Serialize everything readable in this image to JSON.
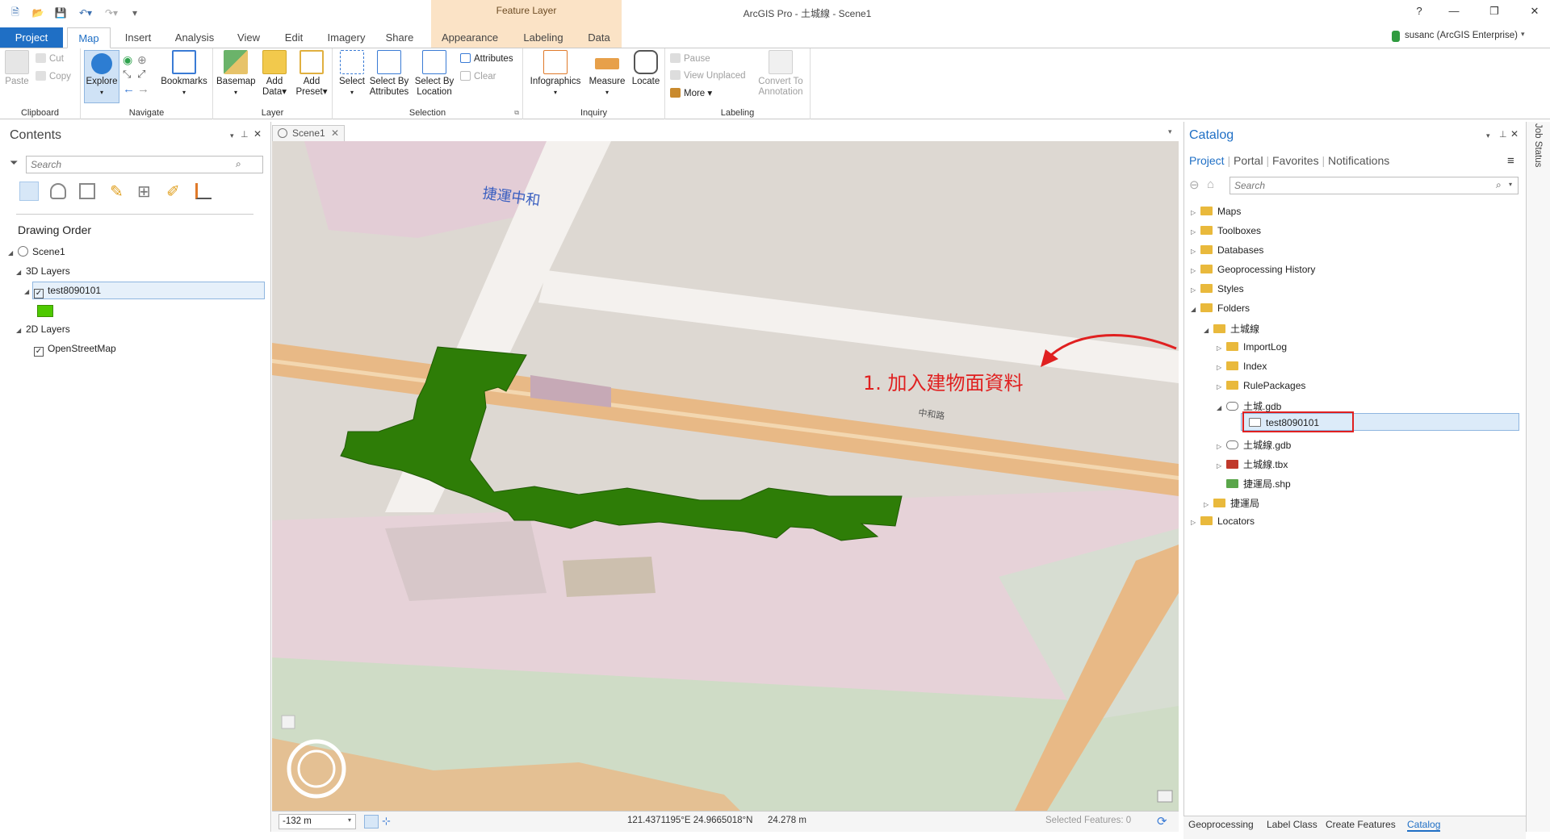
{
  "window": {
    "title": "ArcGIS Pro - 土城線 - Scene1",
    "user": "susanc (ArcGIS Enterprise)",
    "help": "?"
  },
  "ribbon": {
    "context_group": "Feature Layer",
    "tabs": [
      "Project",
      "Map",
      "Insert",
      "Analysis",
      "View",
      "Edit",
      "Imagery",
      "Share",
      "Appearance",
      "Labeling",
      "Data"
    ],
    "active_tab": "Map",
    "groups": {
      "clipboard": {
        "label": "Clipboard",
        "paste": "Paste",
        "cut": "Cut",
        "copy": "Copy"
      },
      "navigate": {
        "label": "Navigate",
        "explore": "Explore",
        "bookmarks": "Bookmarks"
      },
      "layer": {
        "label": "Layer",
        "basemap": "Basemap",
        "add_data": "Add Data",
        "add_preset": "Add Preset"
      },
      "selection": {
        "label": "Selection",
        "select": "Select",
        "select_by_attributes": "Select By Attributes",
        "select_by_location": "Select By Location",
        "attributes": "Attributes",
        "clear": "Clear"
      },
      "inquiry": {
        "label": "Inquiry",
        "infographics": "Infographics",
        "measure": "Measure",
        "locate": "Locate"
      },
      "labeling": {
        "label": "Labeling",
        "pause": "Pause",
        "view_unplaced": "View Unplaced",
        "more": "More",
        "convert": "Convert To Annotation"
      }
    }
  },
  "contents": {
    "title": "Contents",
    "search_placeholder": "Search",
    "drawing_order": "Drawing Order",
    "scene": "Scene1",
    "group_3d": "3D Layers",
    "layer_3d": "test8090101",
    "group_2d": "2D Layers",
    "layer_2d": "OpenStreetMap",
    "symbol_color": "#4ec900"
  },
  "scene_tab": "Scene1",
  "map": {
    "annotation": "1. 加入建物面資料",
    "annotation_color": "#e02020",
    "polygon_color": "#2e7d07",
    "road_color": "#e8b986",
    "street_label": "捷運中和",
    "street_label_2": "中和路"
  },
  "status": {
    "scale": "-132 m",
    "coords": "121.4371195°E 24.9665018°N",
    "elevation": "24.278 m",
    "selected": "Selected Features: 0"
  },
  "catalog": {
    "title": "Catalog",
    "tabs": [
      "Project",
      "Portal",
      "Favorites",
      "Notifications"
    ],
    "search_placeholder": "Search",
    "items": [
      {
        "label": "Maps",
        "level": 0,
        "expanded": false
      },
      {
        "label": "Toolboxes",
        "level": 0,
        "expanded": false
      },
      {
        "label": "Databases",
        "level": 0,
        "expanded": false
      },
      {
        "label": "Geoprocessing History",
        "level": 0,
        "expanded": false
      },
      {
        "label": "Styles",
        "level": 0,
        "expanded": false
      },
      {
        "label": "Folders",
        "level": 0,
        "expanded": true
      },
      {
        "label": "土城線",
        "level": 1,
        "expanded": true
      },
      {
        "label": "ImportLog",
        "level": 2,
        "expanded": false
      },
      {
        "label": "Index",
        "level": 2,
        "expanded": false
      },
      {
        "label": "RulePackages",
        "level": 2,
        "expanded": false
      },
      {
        "label": "土城.gdb",
        "level": 2,
        "expanded": true
      },
      {
        "label": "test8090101",
        "level": 3,
        "expanded": false
      },
      {
        "label": "土城線.gdb",
        "level": 2,
        "expanded": false
      },
      {
        "label": "土城線.tbx",
        "level": 2,
        "expanded": false
      },
      {
        "label": "捷運局.shp",
        "level": 2,
        "expanded": false
      },
      {
        "label": "捷運局",
        "level": 1,
        "expanded": false
      },
      {
        "label": "Locators",
        "level": 0,
        "expanded": false
      }
    ],
    "job_status": "Job Status"
  },
  "bottom_tabs": [
    "Geoprocessing",
    "Label Class",
    "Create Features",
    "Catalog"
  ]
}
